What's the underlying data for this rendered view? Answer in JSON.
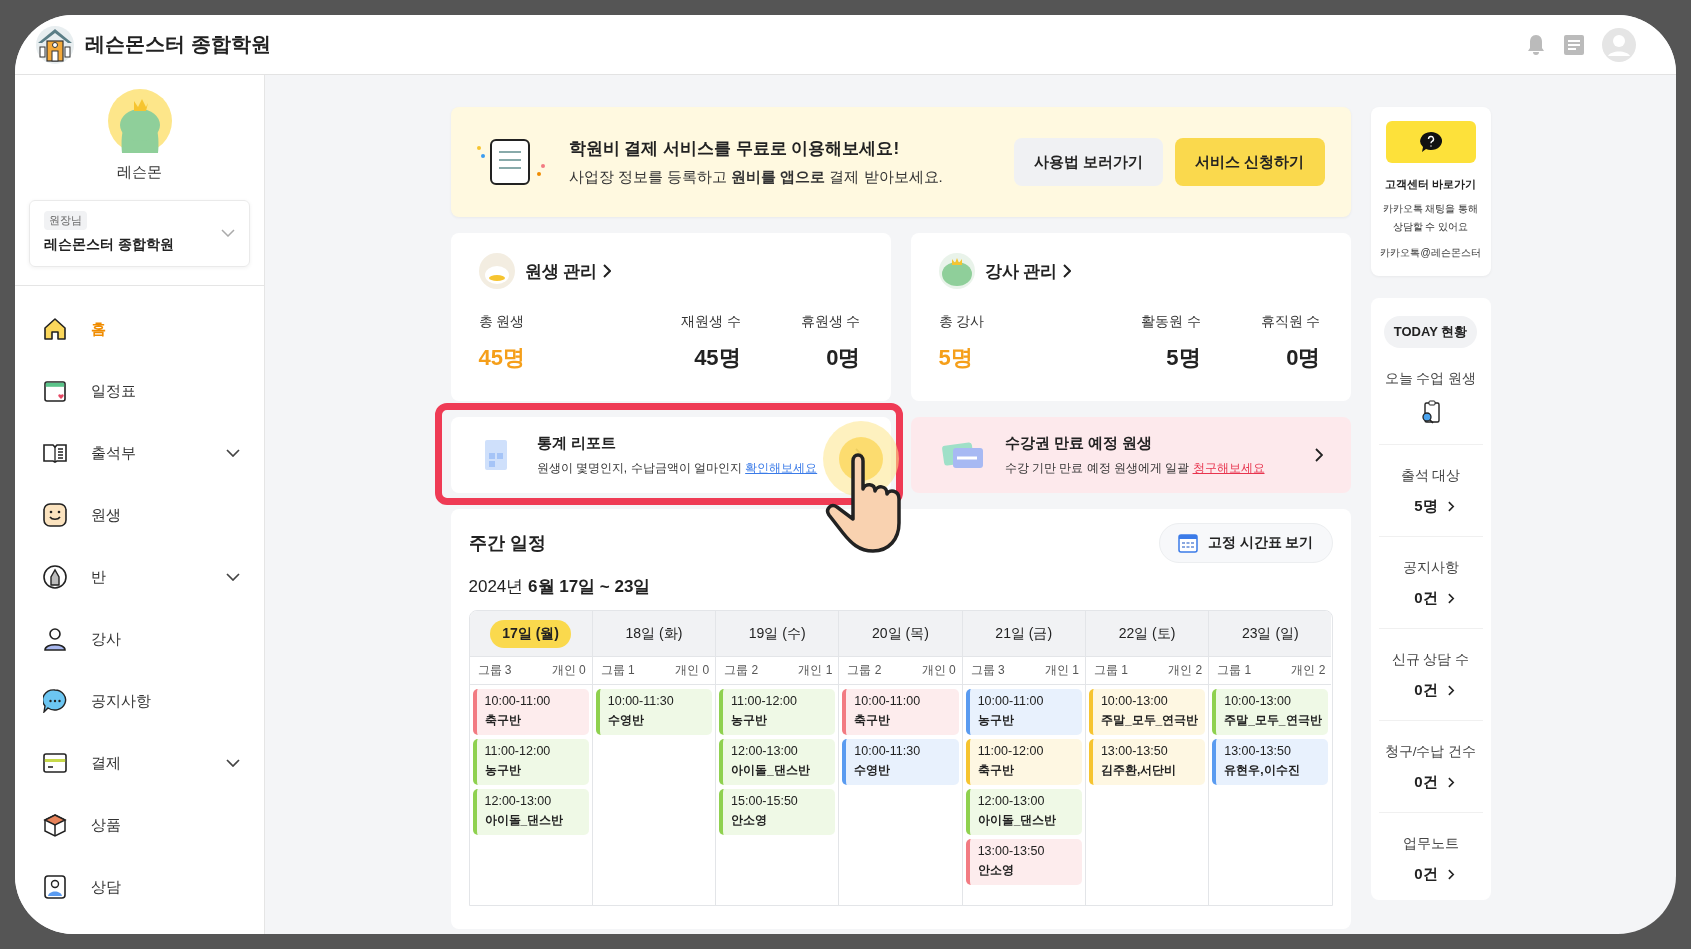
{
  "header": {
    "title": "레슨몬스터 종합학원"
  },
  "profile": {
    "name": "레슨몬",
    "role": "원장님",
    "academy": "레슨몬스터 종합학원"
  },
  "sidebar": {
    "items": [
      {
        "label": "홈",
        "kind": "home",
        "selected": true,
        "expandable": false
      },
      {
        "label": "일정표",
        "kind": "calendar",
        "selected": false,
        "expandable": false
      },
      {
        "label": "출석부",
        "kind": "book",
        "selected": false,
        "expandable": true
      },
      {
        "label": "원생",
        "kind": "smile",
        "selected": false,
        "expandable": false
      },
      {
        "label": "반",
        "kind": "pencil",
        "selected": false,
        "expandable": true
      },
      {
        "label": "강사",
        "kind": "person",
        "selected": false,
        "expandable": false
      },
      {
        "label": "공지사항",
        "kind": "chat",
        "selected": false,
        "expandable": false
      },
      {
        "label": "결제",
        "kind": "card",
        "selected": false,
        "expandable": true
      },
      {
        "label": "상품",
        "kind": "box",
        "selected": false,
        "expandable": false
      },
      {
        "label": "상담",
        "kind": "contact",
        "selected": false,
        "expandable": false
      }
    ]
  },
  "banner": {
    "title": "학원비 결제 서비스를 무료로 이용해보세요!",
    "text": "사업장 정보를 등록하고 **원비를 앱으로** 결제 받아보세요.",
    "buttons": [
      {
        "label": "사용법 보러가기",
        "kind": "secondary"
      },
      {
        "label": "서비스 신청하기",
        "kind": "primary"
      }
    ]
  },
  "summary_cards": [
    {
      "title": "원생 관리",
      "kind": "duck",
      "stats": [
        {
          "label": "총 원생",
          "value": "45명",
          "highlight": true
        },
        {
          "label": "재원생 수",
          "value": "45명",
          "highlight": false
        },
        {
          "label": "휴원생 수",
          "value": "0명",
          "highlight": false
        }
      ]
    },
    {
      "title": "강사 관리",
      "kind": "frog",
      "stats": [
        {
          "label": "총 강사",
          "value": "5명",
          "highlight": true
        },
        {
          "label": "활동원 수",
          "value": "5명",
          "highlight": false
        },
        {
          "label": "휴직원 수",
          "value": "0명",
          "highlight": false
        }
      ]
    }
  ],
  "promo_cards": [
    {
      "title": "통계 리포트",
      "text": "원생이 몇명인지, 수납금액이 얼마인지",
      "link": "확인해보세요",
      "kind": "report",
      "highlighted": true
    },
    {
      "title": "수강권 만료 예정 원생",
      "text": "수강 기만 만료 예정 원생에게 일괄",
      "link": "청구해보세요",
      "kind": "expiry",
      "highlighted": false
    }
  ],
  "schedule": {
    "title": "주간 일정",
    "button": "고정 시간표 보기",
    "range": "2024년 **6월 17일 ~ 23일**",
    "days": [
      {
        "label": "17일 (월)",
        "selected": true,
        "group": "그룹 3",
        "personal": "개인 0",
        "events": [
          {
            "time": "10:00-11:00",
            "name": "축구반",
            "color": "#f27b82"
          },
          {
            "time": "11:00-12:00",
            "name": "농구반",
            "color": "#8fd14f"
          },
          {
            "time": "12:00-13:00",
            "name": "아이돌_댄스반",
            "color": "#8fd14f"
          }
        ]
      },
      {
        "label": "18일 (화)",
        "selected": false,
        "group": "그룹 1",
        "personal": "개인 0",
        "events": [
          {
            "time": "10:00-11:30",
            "name": "수영반",
            "color": "#8fd14f"
          }
        ]
      },
      {
        "label": "19일 (수)",
        "selected": false,
        "group": "그룹 2",
        "personal": "개인 1",
        "events": [
          {
            "time": "11:00-12:00",
            "name": "농구반",
            "color": "#8fd14f"
          },
          {
            "time": "12:00-13:00",
            "name": "아이돌_댄스반",
            "color": "#8fd14f"
          },
          {
            "time": "15:00-15:50",
            "name": "안소영",
            "color": "#8fd14f"
          }
        ]
      },
      {
        "label": "20일 (목)",
        "selected": false,
        "group": "그룹 2",
        "personal": "개인 0",
        "events": [
          {
            "time": "10:00-11:00",
            "name": "축구반",
            "color": "#f27b82"
          },
          {
            "time": "10:00-11:30",
            "name": "수영반",
            "color": "#5a9bf0"
          }
        ]
      },
      {
        "label": "21일 (금)",
        "selected": false,
        "group": "그룹 3",
        "personal": "개인 1",
        "events": [
          {
            "time": "10:00-11:00",
            "name": "농구반",
            "color": "#5a9bf0"
          },
          {
            "time": "11:00-12:00",
            "name": "축구반",
            "color": "#f6c430"
          },
          {
            "time": "12:00-13:00",
            "name": "아이돌_댄스반",
            "color": "#8fd14f"
          },
          {
            "time": "13:00-13:50",
            "name": "안소영",
            "color": "#f27b82"
          }
        ]
      },
      {
        "label": "22일 (토)",
        "selected": false,
        "group": "그룹 1",
        "personal": "개인 2",
        "events": [
          {
            "time": "10:00-13:00",
            "name": "주말_모두_연극반",
            "color": "#f6c430"
          },
          {
            "time": "13:00-13:50",
            "name": "김주환,서단비",
            "color": "#f6c430"
          }
        ]
      },
      {
        "label": "23일 (일)",
        "selected": false,
        "group": "그룹 1",
        "personal": "개인 2",
        "events": [
          {
            "time": "10:00-13:00",
            "name": "주말_모두_연극반",
            "color": "#8fd14f"
          },
          {
            "time": "13:00-13:50",
            "name": "유현우,이수진",
            "color": "#5a9bf0"
          }
        ]
      }
    ]
  },
  "help": {
    "title": "고객센터 바로가기",
    "lines": [
      "카카오톡 채팅을 통해",
      "상담할 수 있어요"
    ],
    "contact": "카카오톡@레슨몬스터"
  },
  "today": {
    "title": "TODAY 현황",
    "items": [
      {
        "label": "오늘 수업 원생",
        "kind": "icon"
      },
      {
        "label": "출석 대상",
        "kind": "count",
        "value": "5명"
      },
      {
        "label": "공지사항",
        "kind": "count",
        "value": "0건"
      },
      {
        "label": "신규 상담 수",
        "kind": "count",
        "value": "0건"
      },
      {
        "label": "청구/수납 건수",
        "kind": "count",
        "value": "0건"
      },
      {
        "label": "업무노트",
        "kind": "count",
        "value": "0건"
      }
    ]
  }
}
